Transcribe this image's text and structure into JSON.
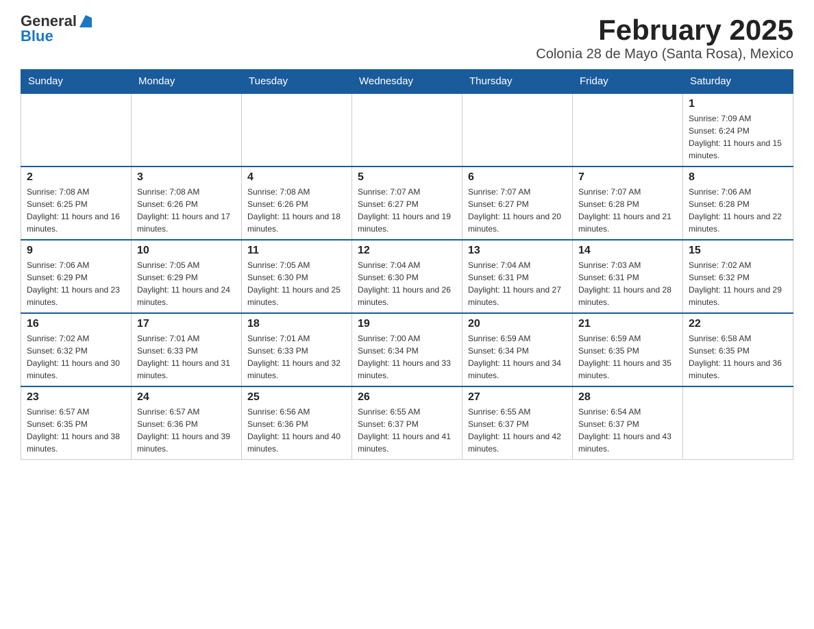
{
  "logo": {
    "general": "General",
    "blue": "Blue"
  },
  "title": "February 2025",
  "subtitle": "Colonia 28 de Mayo (Santa Rosa), Mexico",
  "days_of_week": [
    "Sunday",
    "Monday",
    "Tuesday",
    "Wednesday",
    "Thursday",
    "Friday",
    "Saturday"
  ],
  "weeks": [
    [
      {
        "day": "",
        "info": ""
      },
      {
        "day": "",
        "info": ""
      },
      {
        "day": "",
        "info": ""
      },
      {
        "day": "",
        "info": ""
      },
      {
        "day": "",
        "info": ""
      },
      {
        "day": "",
        "info": ""
      },
      {
        "day": "1",
        "info": "Sunrise: 7:09 AM\nSunset: 6:24 PM\nDaylight: 11 hours and 15 minutes."
      }
    ],
    [
      {
        "day": "2",
        "info": "Sunrise: 7:08 AM\nSunset: 6:25 PM\nDaylight: 11 hours and 16 minutes."
      },
      {
        "day": "3",
        "info": "Sunrise: 7:08 AM\nSunset: 6:26 PM\nDaylight: 11 hours and 17 minutes."
      },
      {
        "day": "4",
        "info": "Sunrise: 7:08 AM\nSunset: 6:26 PM\nDaylight: 11 hours and 18 minutes."
      },
      {
        "day": "5",
        "info": "Sunrise: 7:07 AM\nSunset: 6:27 PM\nDaylight: 11 hours and 19 minutes."
      },
      {
        "day": "6",
        "info": "Sunrise: 7:07 AM\nSunset: 6:27 PM\nDaylight: 11 hours and 20 minutes."
      },
      {
        "day": "7",
        "info": "Sunrise: 7:07 AM\nSunset: 6:28 PM\nDaylight: 11 hours and 21 minutes."
      },
      {
        "day": "8",
        "info": "Sunrise: 7:06 AM\nSunset: 6:28 PM\nDaylight: 11 hours and 22 minutes."
      }
    ],
    [
      {
        "day": "9",
        "info": "Sunrise: 7:06 AM\nSunset: 6:29 PM\nDaylight: 11 hours and 23 minutes."
      },
      {
        "day": "10",
        "info": "Sunrise: 7:05 AM\nSunset: 6:29 PM\nDaylight: 11 hours and 24 minutes."
      },
      {
        "day": "11",
        "info": "Sunrise: 7:05 AM\nSunset: 6:30 PM\nDaylight: 11 hours and 25 minutes."
      },
      {
        "day": "12",
        "info": "Sunrise: 7:04 AM\nSunset: 6:30 PM\nDaylight: 11 hours and 26 minutes."
      },
      {
        "day": "13",
        "info": "Sunrise: 7:04 AM\nSunset: 6:31 PM\nDaylight: 11 hours and 27 minutes."
      },
      {
        "day": "14",
        "info": "Sunrise: 7:03 AM\nSunset: 6:31 PM\nDaylight: 11 hours and 28 minutes."
      },
      {
        "day": "15",
        "info": "Sunrise: 7:02 AM\nSunset: 6:32 PM\nDaylight: 11 hours and 29 minutes."
      }
    ],
    [
      {
        "day": "16",
        "info": "Sunrise: 7:02 AM\nSunset: 6:32 PM\nDaylight: 11 hours and 30 minutes."
      },
      {
        "day": "17",
        "info": "Sunrise: 7:01 AM\nSunset: 6:33 PM\nDaylight: 11 hours and 31 minutes."
      },
      {
        "day": "18",
        "info": "Sunrise: 7:01 AM\nSunset: 6:33 PM\nDaylight: 11 hours and 32 minutes."
      },
      {
        "day": "19",
        "info": "Sunrise: 7:00 AM\nSunset: 6:34 PM\nDaylight: 11 hours and 33 minutes."
      },
      {
        "day": "20",
        "info": "Sunrise: 6:59 AM\nSunset: 6:34 PM\nDaylight: 11 hours and 34 minutes."
      },
      {
        "day": "21",
        "info": "Sunrise: 6:59 AM\nSunset: 6:35 PM\nDaylight: 11 hours and 35 minutes."
      },
      {
        "day": "22",
        "info": "Sunrise: 6:58 AM\nSunset: 6:35 PM\nDaylight: 11 hours and 36 minutes."
      }
    ],
    [
      {
        "day": "23",
        "info": "Sunrise: 6:57 AM\nSunset: 6:35 PM\nDaylight: 11 hours and 38 minutes."
      },
      {
        "day": "24",
        "info": "Sunrise: 6:57 AM\nSunset: 6:36 PM\nDaylight: 11 hours and 39 minutes."
      },
      {
        "day": "25",
        "info": "Sunrise: 6:56 AM\nSunset: 6:36 PM\nDaylight: 11 hours and 40 minutes."
      },
      {
        "day": "26",
        "info": "Sunrise: 6:55 AM\nSunset: 6:37 PM\nDaylight: 11 hours and 41 minutes."
      },
      {
        "day": "27",
        "info": "Sunrise: 6:55 AM\nSunset: 6:37 PM\nDaylight: 11 hours and 42 minutes."
      },
      {
        "day": "28",
        "info": "Sunrise: 6:54 AM\nSunset: 6:37 PM\nDaylight: 11 hours and 43 minutes."
      },
      {
        "day": "",
        "info": ""
      }
    ]
  ]
}
